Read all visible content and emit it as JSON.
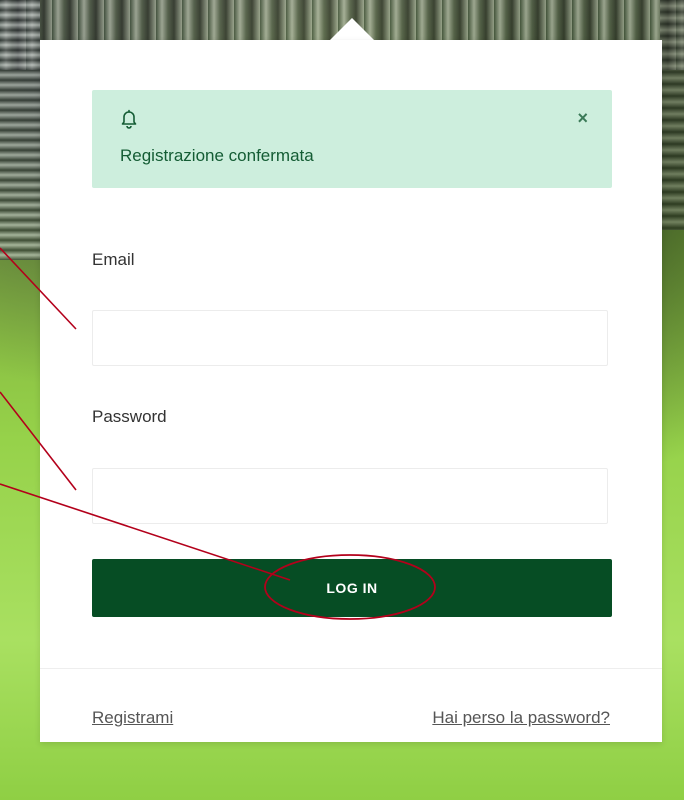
{
  "alert": {
    "message": "Registrazione confermata",
    "close_glyph": "×",
    "icon": "bell-icon"
  },
  "form": {
    "email_label": "Email",
    "email_value": "",
    "password_label": "Password",
    "password_value": "",
    "login_label": "LOG IN"
  },
  "footer": {
    "register_label": "Registrami",
    "lost_password_label": "Hai perso la password?"
  },
  "colors": {
    "alert_bg": "#cdeedd",
    "alert_text": "#145c34",
    "button_bg": "#064d24",
    "annotation": "#b3001b"
  }
}
